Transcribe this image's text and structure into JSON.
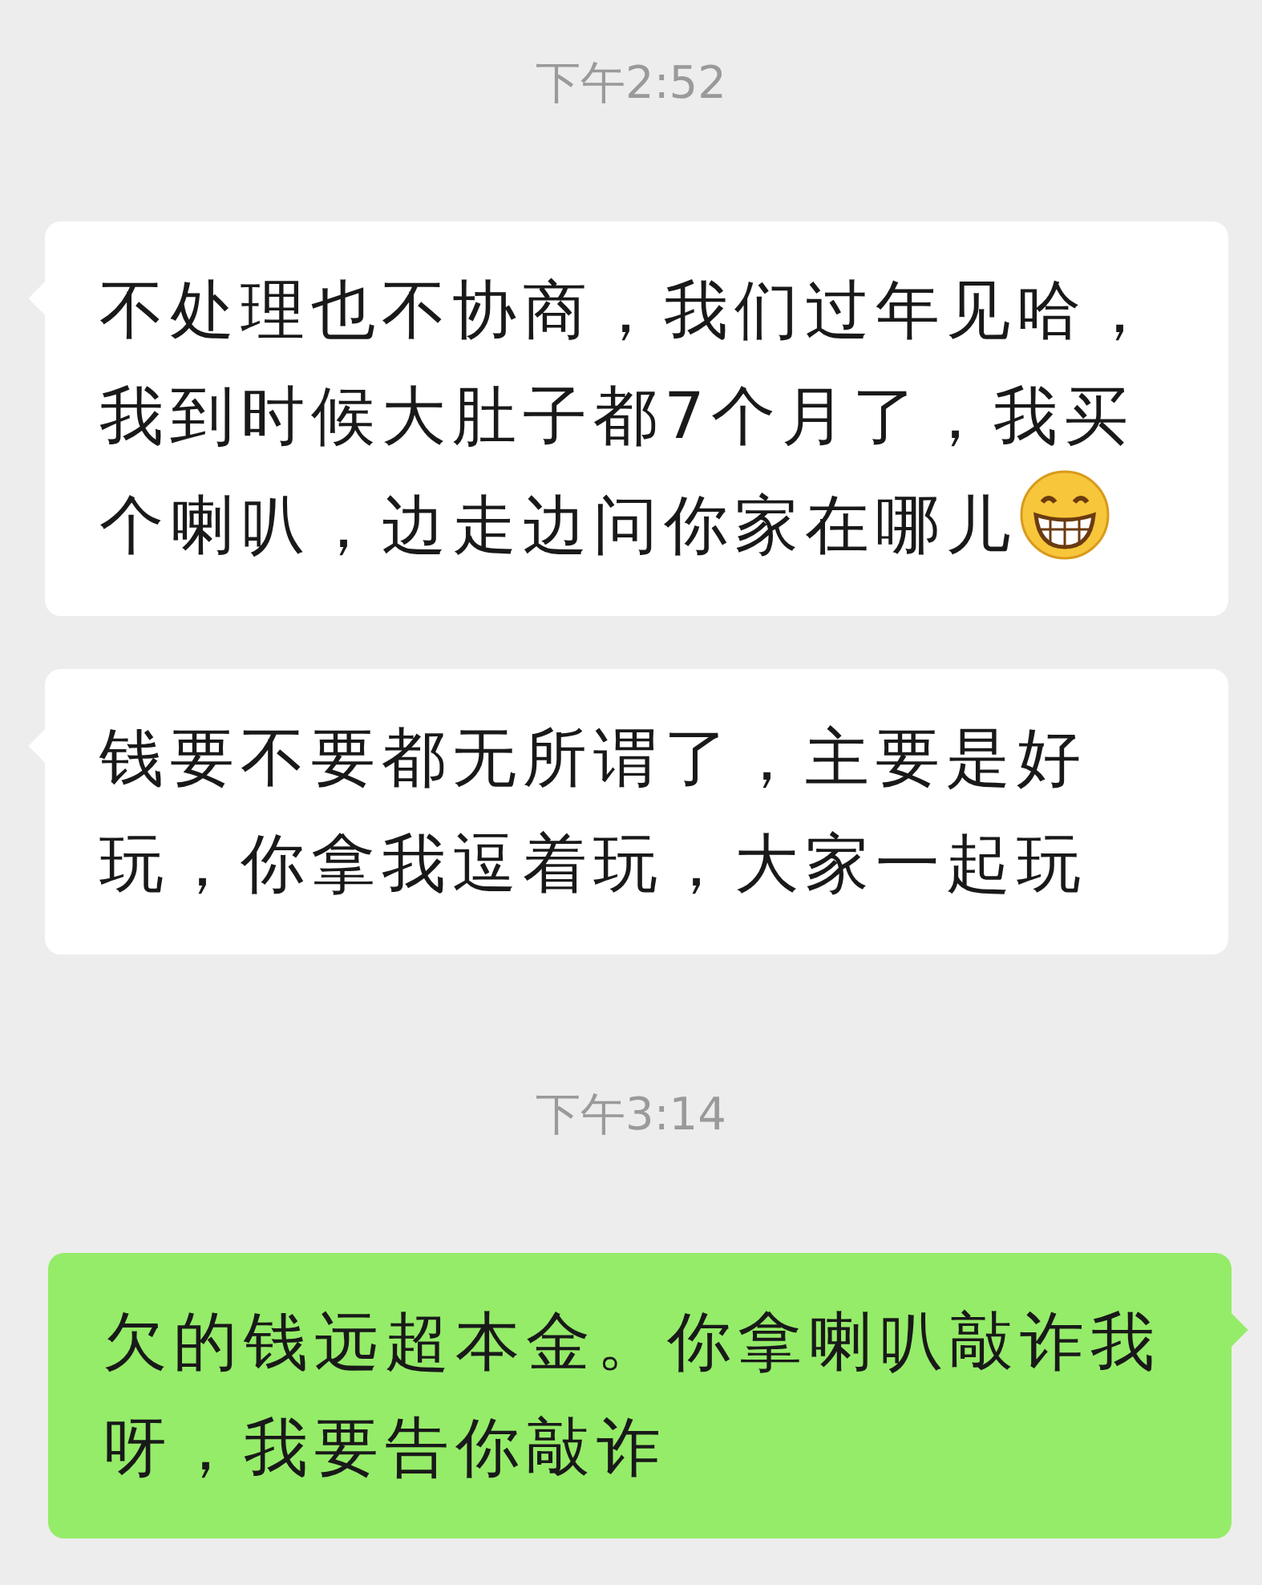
{
  "messages": [
    {
      "kind": "time",
      "text": "下午2:52"
    },
    {
      "kind": "bubble",
      "outgoing": false,
      "text": "不处理也不协商，我们过年见哈，我到时候大肚子都7个月了，我买个喇叭，边走边问你家在哪儿",
      "emoji": true
    },
    {
      "kind": "bubble",
      "outgoing": false,
      "text": "钱要不要都无所谓了，主要是好玩，你拿我逗着玩，大家一起玩",
      "emoji": false
    },
    {
      "kind": "time",
      "text": "下午3:14"
    },
    {
      "kind": "bubble",
      "outgoing": true,
      "text": "欠的钱远超本金。你拿喇叭敲诈我呀，我要告你敲诈",
      "emoji": false
    }
  ]
}
